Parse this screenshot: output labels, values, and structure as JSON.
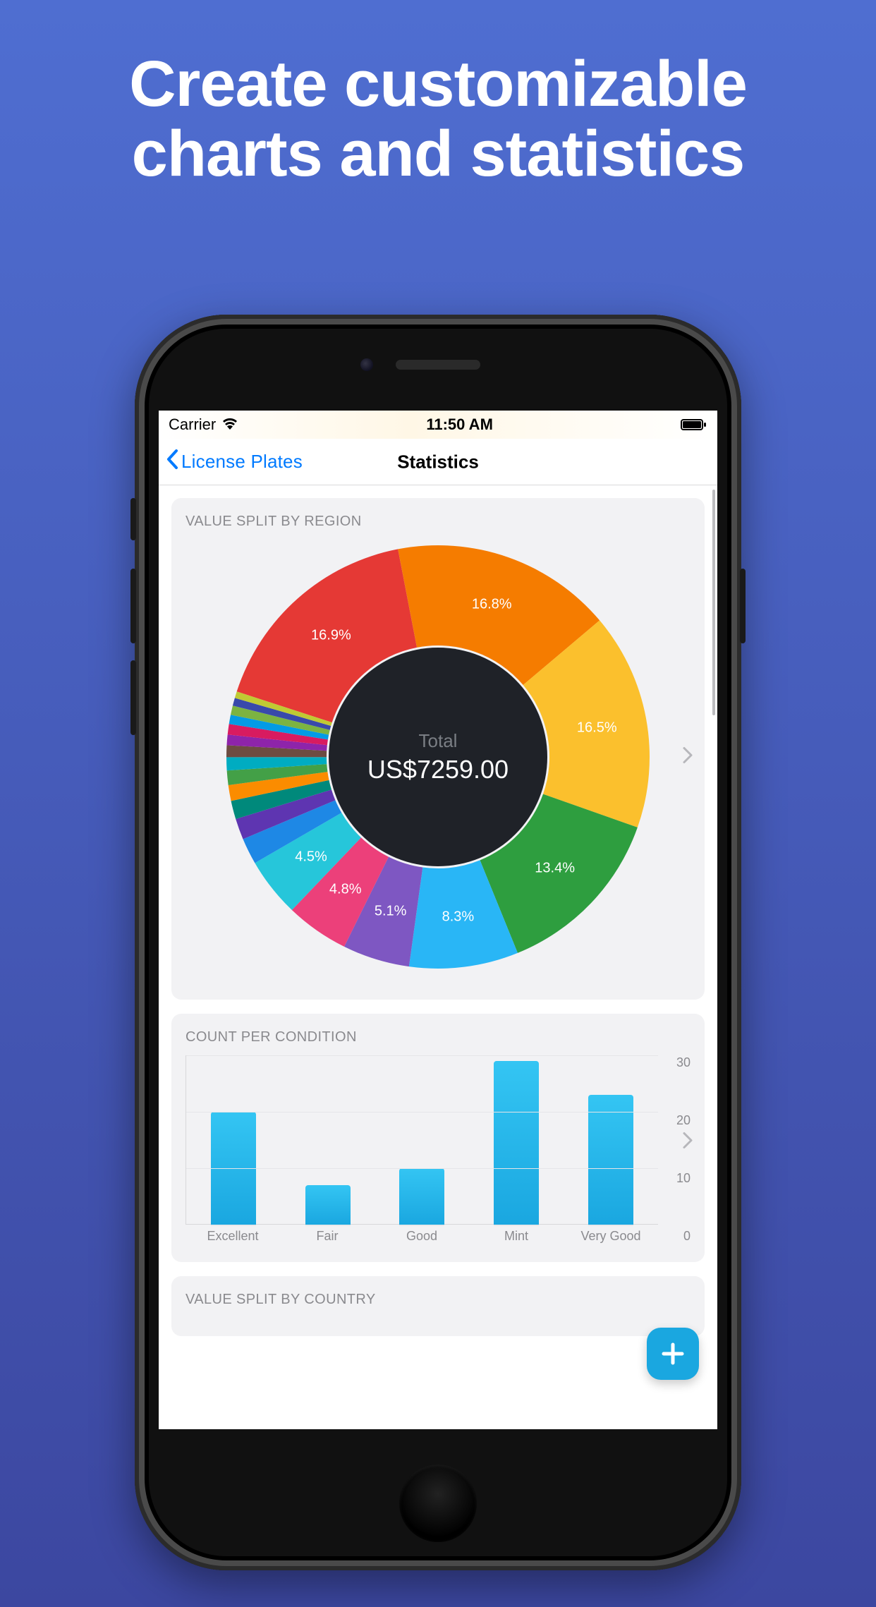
{
  "promo": {
    "headline_line1": "Create customizable",
    "headline_line2": "charts and statistics"
  },
  "status": {
    "carrier": "Carrier",
    "time": "11:50 AM"
  },
  "nav": {
    "back_label": "License Plates",
    "title": "Statistics"
  },
  "card1": {
    "title": "VALUE SPLIT BY REGION",
    "center_label": "Total",
    "center_value": "US$7259.00"
  },
  "card2": {
    "title": "COUNT PER CONDITION"
  },
  "card3": {
    "title": "VALUE SPLIT BY COUNTRY"
  },
  "colors": {
    "accent": "#007aff",
    "fab": "#1aa7e0"
  },
  "chart_data": [
    {
      "type": "pie",
      "title": "VALUE SPLIT BY REGION",
      "total_label": "Total",
      "total_value": "US$7259.00",
      "slices": [
        {
          "label": "16.9%",
          "value": 16.9,
          "color": "#e53935"
        },
        {
          "label": "16.8%",
          "value": 16.8,
          "color": "#f57c00"
        },
        {
          "label": "16.5%",
          "value": 16.5,
          "color": "#fbc02d"
        },
        {
          "label": "13.4%",
          "value": 13.4,
          "color": "#2e9e3f"
        },
        {
          "label": "8.3%",
          "value": 8.3,
          "color": "#29b6f6"
        },
        {
          "label": "5.1%",
          "value": 5.1,
          "color": "#7e57c2"
        },
        {
          "label": "4.8%",
          "value": 4.8,
          "color": "#ec407a"
        },
        {
          "label": "4.5%",
          "value": 4.5,
          "color": "#26c6da"
        },
        {
          "label": "",
          "value": 2.0,
          "color": "#1e88e5"
        },
        {
          "label": "",
          "value": 1.6,
          "color": "#5e35b1"
        },
        {
          "label": "",
          "value": 1.4,
          "color": "#00897b"
        },
        {
          "label": "",
          "value": 1.2,
          "color": "#fb8c00"
        },
        {
          "label": "",
          "value": 1.1,
          "color": "#43a047"
        },
        {
          "label": "",
          "value": 1.0,
          "color": "#00acc1"
        },
        {
          "label": "",
          "value": 0.9,
          "color": "#6d4c41"
        },
        {
          "label": "",
          "value": 0.8,
          "color": "#8e24aa"
        },
        {
          "label": "",
          "value": 0.8,
          "color": "#d81b60"
        },
        {
          "label": "",
          "value": 0.7,
          "color": "#039be5"
        },
        {
          "label": "",
          "value": 0.7,
          "color": "#7cb342"
        },
        {
          "label": "",
          "value": 0.6,
          "color": "#3949ab"
        },
        {
          "label": "",
          "value": 0.5,
          "color": "#c0ca33"
        }
      ]
    },
    {
      "type": "bar",
      "title": "COUNT PER CONDITION",
      "categories": [
        "Excellent",
        "Fair",
        "Good",
        "Mint",
        "Very Good"
      ],
      "values": [
        20,
        7,
        10,
        29,
        23
      ],
      "ylim": [
        0,
        30
      ],
      "yticks": [
        0,
        10,
        20,
        30
      ],
      "bar_color": "#29b6f6"
    }
  ]
}
